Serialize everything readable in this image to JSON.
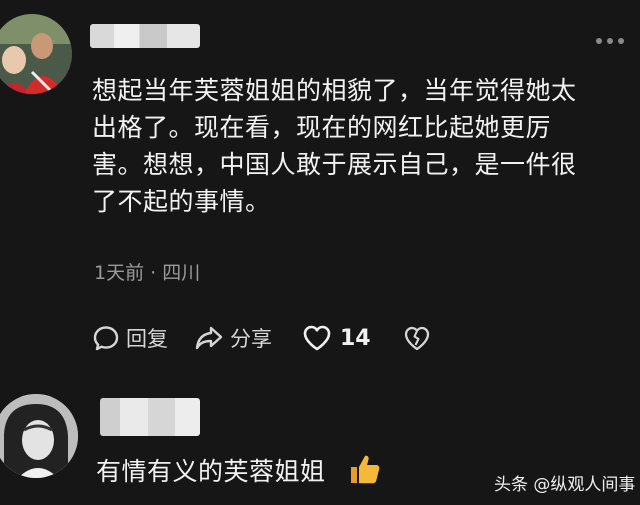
{
  "comment": {
    "lines": [
      "想起当年芙蓉姐姐的相貌了，当年觉得她太",
      "出格了。现在看，现在的网红比起她更厉",
      "害。想想，中国人敢于展示自己，是一件很",
      "了不起的事情。"
    ],
    "meta": "1天前 · 四川",
    "actions": {
      "reply_label": "回复",
      "share_label": "分享",
      "like_count": "14"
    }
  },
  "reply": {
    "text": "有情有义的芙蓉姐姐"
  },
  "watermark": "头条 @纵观人间事",
  "colors": {
    "background": "#161616",
    "text": "#f2f2f2",
    "secondary": "#9a9a9a",
    "emoji": "#f3b33c"
  }
}
